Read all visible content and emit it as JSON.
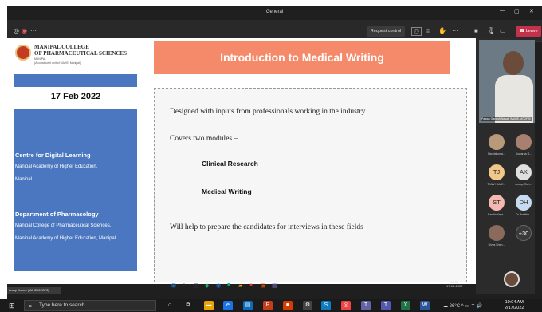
{
  "window": {
    "title": "General",
    "min": "—",
    "max": "▢",
    "close": "✕"
  },
  "meeting_bar": {
    "request_control_label": "Request control",
    "leave_label": "Leave",
    "more_label": "···"
  },
  "slide": {
    "logo": {
      "line1": "MANIPAL COLLEGE",
      "line2": "OF PHARMACEUTICAL SCIENCES",
      "line3": "MANIPAL",
      "line4": "(A constituent unit of MAHE, Manipal)"
    },
    "date": "17 Feb 2022",
    "left_heading1": "Centre for Digital Learning",
    "left_line1": "Manipal Academy of Higher Education,",
    "left_line2": "Manipal",
    "left_heading2": "Department of Pharmacology",
    "left_line3": "Manipal College of Pharmaceutical Sciences,",
    "left_line4": "Manipal Academy of Higher Education, Manipal",
    "title": "Introduction to Medical Writing",
    "bullet1": "Designed with inputs from professionals working in the industry",
    "bullet2": "Covers two modules –",
    "module1": "Clinical Research",
    "module2": "Medical Writing",
    "bullet3": "Will help to prepare the candidates for interviews in these fields"
  },
  "presenter": {
    "name": "Pawan Ganesh Nayak (MAHE-MCOPS)"
  },
  "participants": [
    {
      "initials": "",
      "name": "Nandakuma...",
      "color": "#b89a7a"
    },
    {
      "initials": "",
      "name": "Suwarna G...",
      "color": "#a88070"
    },
    {
      "initials": "TJ",
      "name": "TANVI RAJE...",
      "color": "#f2c88a"
    },
    {
      "initials": "AK",
      "name": "Anoop Rich...",
      "color": "#e0e0e0"
    },
    {
      "initials": "ST",
      "name": "Sandia Yaya...",
      "color": "#f4b8b0"
    },
    {
      "initials": "DH",
      "name": "Dr. Anvitha...",
      "color": "#c8daf0"
    },
    {
      "initials": "",
      "name": "Divya Shen...",
      "color": "#8a6a5a"
    },
    {
      "initials": "+30",
      "name": "",
      "color": "#3a3a3a"
    }
  ],
  "name_badge": "Anoop Kishore (MAHE-MCOPS)",
  "inner_clock": {
    "time": "10:11",
    "date": "17-02-2022"
  },
  "taskbar": {
    "search_placeholder": "Type here to search",
    "tray_temp": "26°C",
    "time": "10:04 AM",
    "date": "2/17/2022"
  },
  "colors": {
    "title_bar": "#f48a6a",
    "side_blue": "#4a77bf",
    "leave": "#c4314b"
  }
}
